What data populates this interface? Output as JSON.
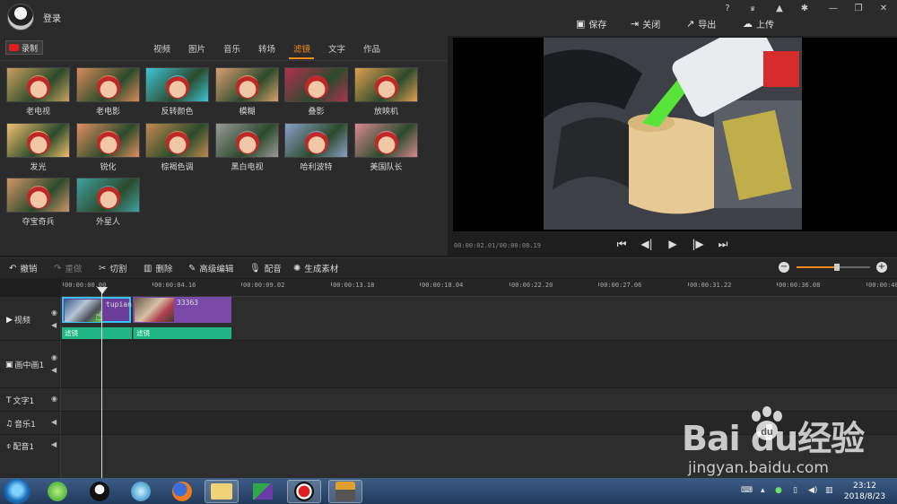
{
  "app": {
    "login_label": "登录",
    "window_buttons": [
      "?",
      "VIP",
      "bell",
      "gear",
      "minimize",
      "restore",
      "close"
    ],
    "actions": {
      "save": "保存",
      "close": "关闭",
      "export": "导出",
      "upload": "上传"
    }
  },
  "media_panel": {
    "record_label": "录制",
    "tabs": [
      "视频",
      "图片",
      "音乐",
      "转场",
      "滤镜",
      "文字",
      "作品"
    ],
    "active_tab": "滤镜",
    "filters": [
      {
        "label": "老电视",
        "tint": "#c9a060"
      },
      {
        "label": "老电影",
        "tint": "#d98b59"
      },
      {
        "label": "反转颜色",
        "tint": "#3ec6d9"
      },
      {
        "label": "模糊",
        "tint": "#d9a070"
      },
      {
        "label": "叠影",
        "tint": "#b03050"
      },
      {
        "label": "放映机",
        "tint": "#e0a050"
      },
      {
        "label": "发光",
        "tint": "#f0c070"
      },
      {
        "label": "锐化",
        "tint": "#e09060"
      },
      {
        "label": "棕褐色调",
        "tint": "#c08a50"
      },
      {
        "label": "黑白电视",
        "tint": "#9a9a9a"
      },
      {
        "label": "哈利波特",
        "tint": "#8aa0c8"
      },
      {
        "label": "美国队长",
        "tint": "#d88a90"
      },
      {
        "label": "夺宝奇兵",
        "tint": "#d0956a"
      },
      {
        "label": "外星人",
        "tint": "#40a0a0"
      }
    ]
  },
  "preview": {
    "timecode": "00:00:02.01/00:00:08.19",
    "controls": [
      "skip-to-start",
      "step-back",
      "play",
      "step-forward",
      "skip-to-end"
    ]
  },
  "toolbar": {
    "undo": "撤销",
    "redo": "重做",
    "cut": "切割",
    "delete": "删除",
    "advanced_edit": "高级编辑",
    "dub": "配音",
    "generate": "生成素材",
    "zoom_level": 0.55
  },
  "timeline": {
    "ruler_labels": [
      "00:00:00.00",
      "00:00:04.16",
      "00:00:09.02",
      "00:00:13.18",
      "00:00:18.04",
      "00:00:22.20",
      "00:00:27.06",
      "00:00:31.22",
      "00:00:36.08",
      "00:00:40.2"
    ],
    "tracks": [
      {
        "label": "视频",
        "icon": "play-icon",
        "eye": true,
        "speaker": true
      },
      {
        "label": "画中画1",
        "icon": "pip-icon",
        "eye": true,
        "speaker": true
      },
      {
        "label": "文字1",
        "icon": "text-icon",
        "eye": true,
        "speaker": false
      },
      {
        "label": "音乐1",
        "icon": "music-icon",
        "eye": false,
        "speaker": true
      },
      {
        "label": "配音1",
        "icon": "mic-icon",
        "eye": false,
        "speaker": true
      }
    ],
    "clips": [
      {
        "name": "tupian"
      },
      {
        "name": "33363"
      }
    ],
    "filter_label": "滤镜"
  },
  "taskbar": {
    "time": "23:12",
    "date": "2018/8/23"
  },
  "watermark": {
    "logo": "Bai  du经验",
    "url": "jingyan.baidu.com"
  },
  "colors": {
    "accent": "#f08a1c",
    "filter_bar": "#20b584",
    "clip": "#7a4aa8",
    "clip_selected": "#36c3f0"
  }
}
